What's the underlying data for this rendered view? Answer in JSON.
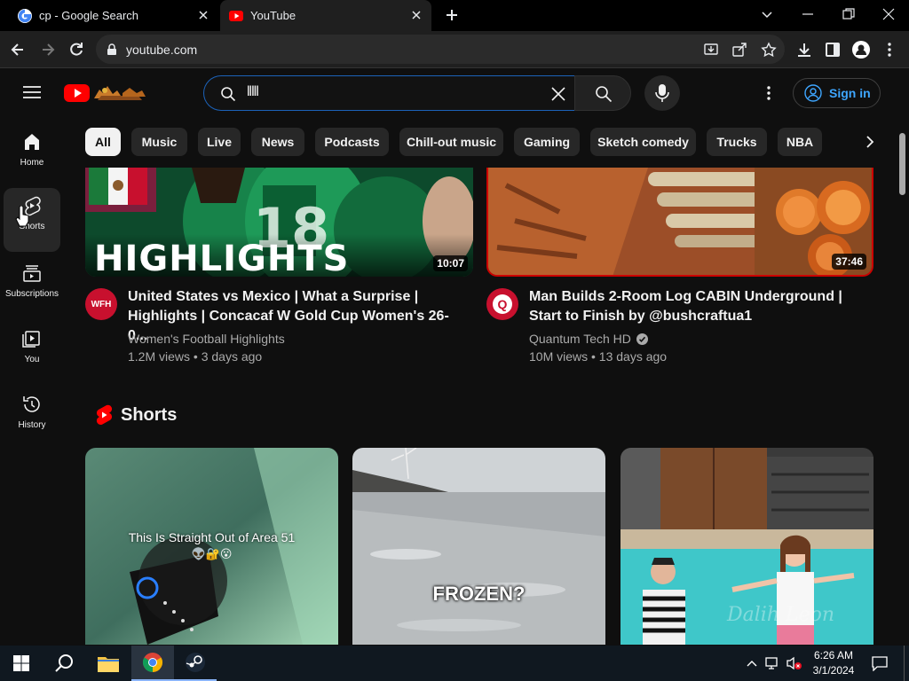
{
  "browser": {
    "tabs": [
      {
        "title": "cp - Google Search",
        "icon": "google-icon"
      },
      {
        "title": "YouTube",
        "icon": "youtube-icon",
        "active": true
      }
    ],
    "url": "youtube.com"
  },
  "youtube": {
    "search_value": "lllll",
    "sign_in": "Sign in",
    "chips": [
      "All",
      "Music",
      "Live",
      "News",
      "Podcasts",
      "Chill-out music",
      "Gaming",
      "Sketch comedy",
      "Trucks",
      "NBA"
    ],
    "sidebar": [
      {
        "label": "Home",
        "icon": "home-icon"
      },
      {
        "label": "Shorts",
        "icon": "shorts-icon"
      },
      {
        "label": "Subscriptions",
        "icon": "subscriptions-icon"
      },
      {
        "label": "You",
        "icon": "you-icon"
      },
      {
        "label": "History",
        "icon": "history-icon"
      }
    ],
    "videos": [
      {
        "title_line1": "United States vs Mexico | What a Surprise |",
        "title_line2": "Highlights | Concacaf W Gold Cup Women's 26-0...",
        "channel": "Women's Football Highlights",
        "meta": "1.2M views • 3 days ago",
        "duration": "10:07",
        "thumb_text": "HIGHLIGHTS",
        "jersey_text": "18",
        "avatar_text": "WFH"
      },
      {
        "title_line1": "Man Builds 2-Room Log CABIN Underground |",
        "title_line2": "Start to Finish by @bushcraftua1",
        "channel": "Quantum Tech HD",
        "meta": "10M views • 13 days ago",
        "duration": "37:46",
        "verified": true,
        "avatar_text": "Q"
      }
    ],
    "shorts_heading": "Shorts",
    "shorts": [
      {
        "caption": "This Is Straight Out of Area 51",
        "emoji": "👽🔐😮"
      },
      {
        "caption": "FROZEN?"
      },
      {
        "caption": "",
        "watermark": "Dalih Leon"
      }
    ]
  },
  "taskbar": {
    "time": "6:26 AM",
    "date": "3/1/2024"
  },
  "colors": {
    "youtube_red": "#ff0000",
    "link_blue": "#3ea6ff",
    "background": "#0f0f0f",
    "chip_bg": "#272727"
  }
}
